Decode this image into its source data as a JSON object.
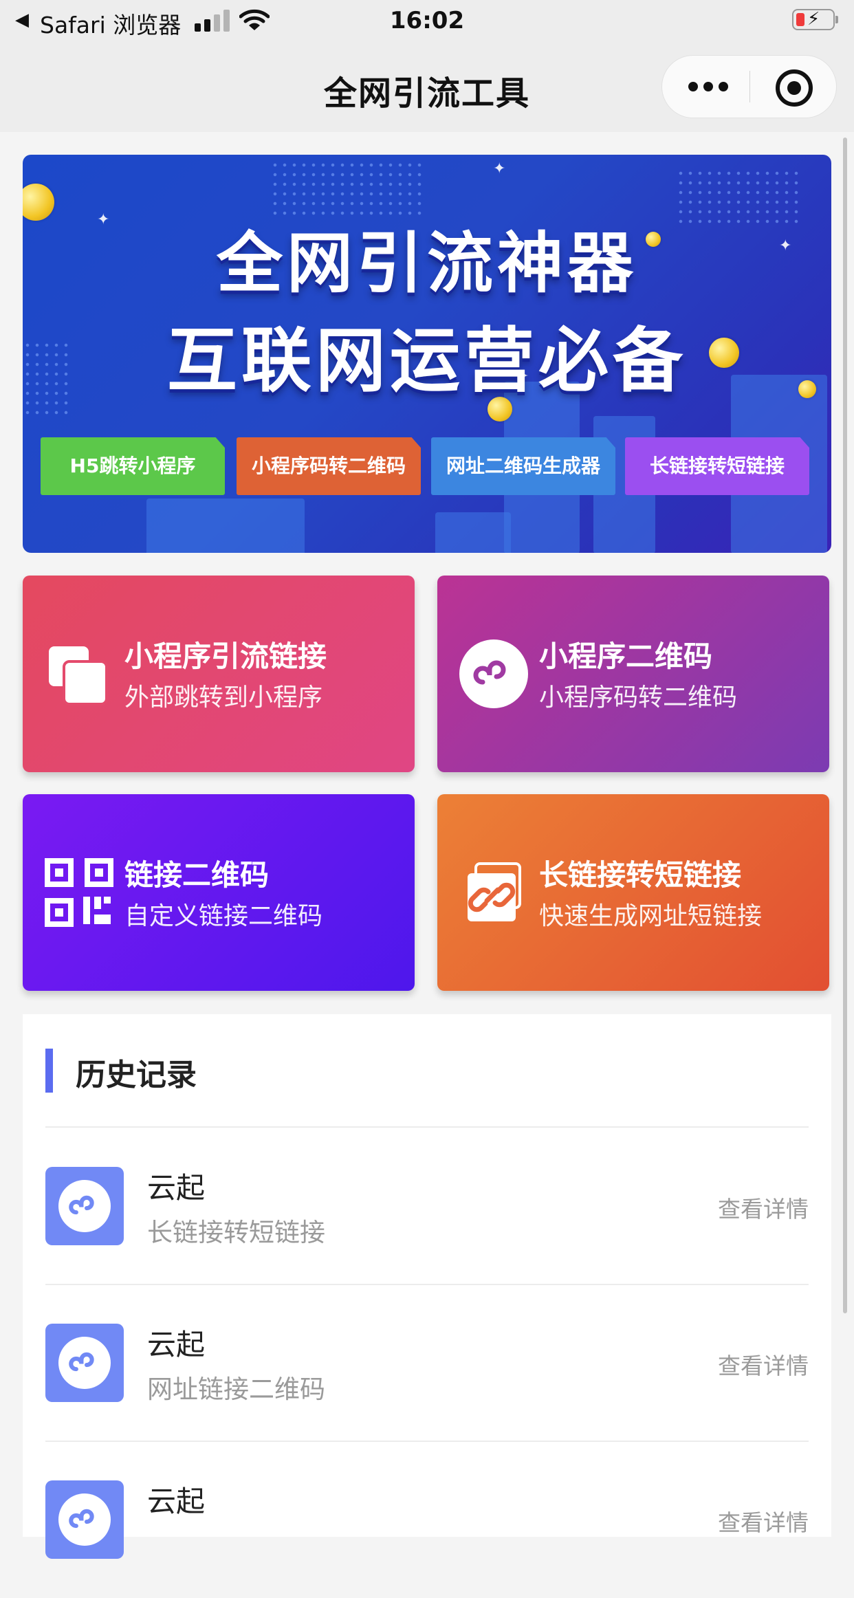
{
  "status_bar": {
    "back_icon": "◀",
    "carrier": "Safari 浏览器",
    "time": "16:02",
    "signal_icon": "cellular-signal-icon",
    "wifi_icon": "wifi-icon",
    "battery_icon": "battery-charging-icon",
    "battery_color": "#ef3b3b"
  },
  "nav_bar": {
    "title": "全网引流工具",
    "menu_icon": "more-dots-icon",
    "close_icon": "mini-program-close-icon"
  },
  "banner": {
    "line1": "全网引流神器",
    "line2": "互联网运营必备",
    "tags": [
      {
        "label": "H5跳转小程序",
        "color": "#5cc84a"
      },
      {
        "label": "小程序码转二维码",
        "color": "#de6235"
      },
      {
        "label": "网址二维码生成器",
        "color": "#3c86e0"
      },
      {
        "label": "长链接转短链接",
        "color": "#9b4ff0"
      }
    ]
  },
  "features": [
    {
      "title": "小程序引流链接",
      "subtitle": "外部跳转到小程序",
      "icon": "copy-squares-icon",
      "gradient": [
        "#e4495f",
        "#e04684"
      ]
    },
    {
      "title": "小程序二维码",
      "subtitle": "小程序码转二维码",
      "icon": "mini-program-logo-icon",
      "gradient": [
        "#bb3394",
        "#7c3bb2"
      ]
    },
    {
      "title": "链接二维码",
      "subtitle": "自定义链接二维码",
      "icon": "qr-code-icon",
      "gradient": [
        "#7a1af2",
        "#4e17ec"
      ]
    },
    {
      "title": "长链接转短链接",
      "subtitle": "快速生成网址短链接",
      "icon": "link-chain-icon",
      "gradient": [
        "#ec8036",
        "#e24f32"
      ]
    }
  ],
  "history": {
    "title": "历史记录",
    "accent": "#5b6cf0",
    "items": [
      {
        "name": "云起",
        "desc": "长链接转短链接",
        "action": "查看详情"
      },
      {
        "name": "云起",
        "desc": "网址链接二维码",
        "action": "查看详情"
      },
      {
        "name": "云起",
        "desc": "",
        "action": "查看详情"
      }
    ]
  }
}
